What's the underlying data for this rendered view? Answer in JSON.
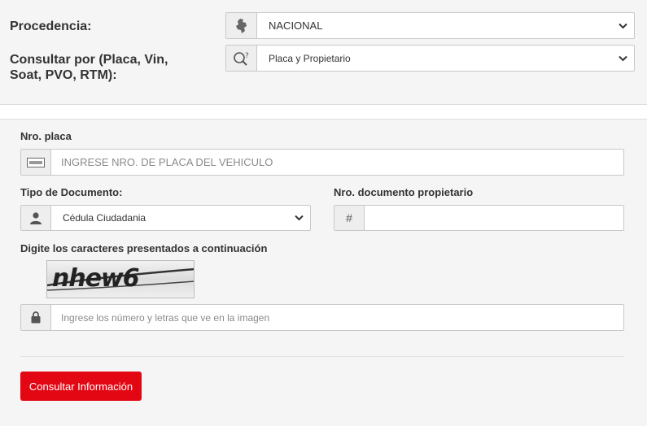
{
  "procedencia": {
    "label": "Procedencia:",
    "value": "NACIONAL",
    "icon": "colombia-map-icon"
  },
  "consultar_por": {
    "label_line1": "Consultar por (Placa, Vin,",
    "label_line2": "Soat, PVO, RTM):",
    "value": "Placa y Propietario",
    "icon": "search-question-icon"
  },
  "placa": {
    "label": "Nro. placa",
    "placeholder": "INGRESE NRO. DE PLACA DEL VEHICULO",
    "icon": "license-plate-icon"
  },
  "tipo_documento": {
    "label": "Tipo de Documento:",
    "value": "Cédula Ciudadania",
    "icon": "user-icon"
  },
  "documento": {
    "label": "Nro. documento propietario",
    "addon": "#",
    "value": ""
  },
  "captcha": {
    "label": "Digite los caracteres presentados a continuación",
    "text": "nhew6",
    "placeholder": "Ingrese los número y letras que ve en la imagen",
    "icon": "lock-icon"
  },
  "submit": {
    "label": "Consultar Información",
    "color": "#e30613"
  }
}
